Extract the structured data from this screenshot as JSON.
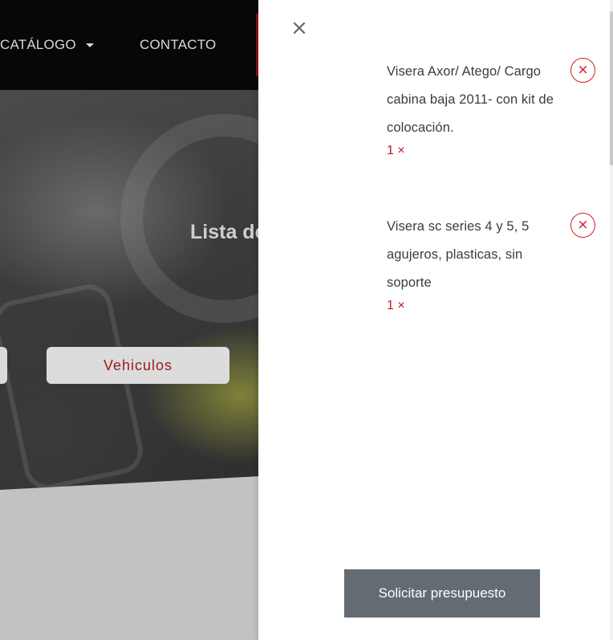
{
  "navbar": {
    "catalogo_label": "CATÁLOGO",
    "contacto_label": "CONTACTO"
  },
  "hero": {
    "title_partial": "Lista de",
    "vehiculos_button": "Vehiculos"
  },
  "cart_panel": {
    "close_icon": "×",
    "items": [
      {
        "name": "Visera Axor/ Atego/ Cargo cabina baja 2011- con kit de colocación.",
        "quantity": "1 ×",
        "remove_icon": "⨯"
      },
      {
        "name": "Visera sc series 4 y 5, 5 agujeros, plasticas, sin soporte",
        "quantity": "1 ×",
        "remove_icon": "⨯"
      }
    ],
    "request_button": "Solicitar presupuesto"
  },
  "colors": {
    "accent_red": "#d21b22",
    "button_gray": "#646b73",
    "navbar_black": "#070707"
  }
}
